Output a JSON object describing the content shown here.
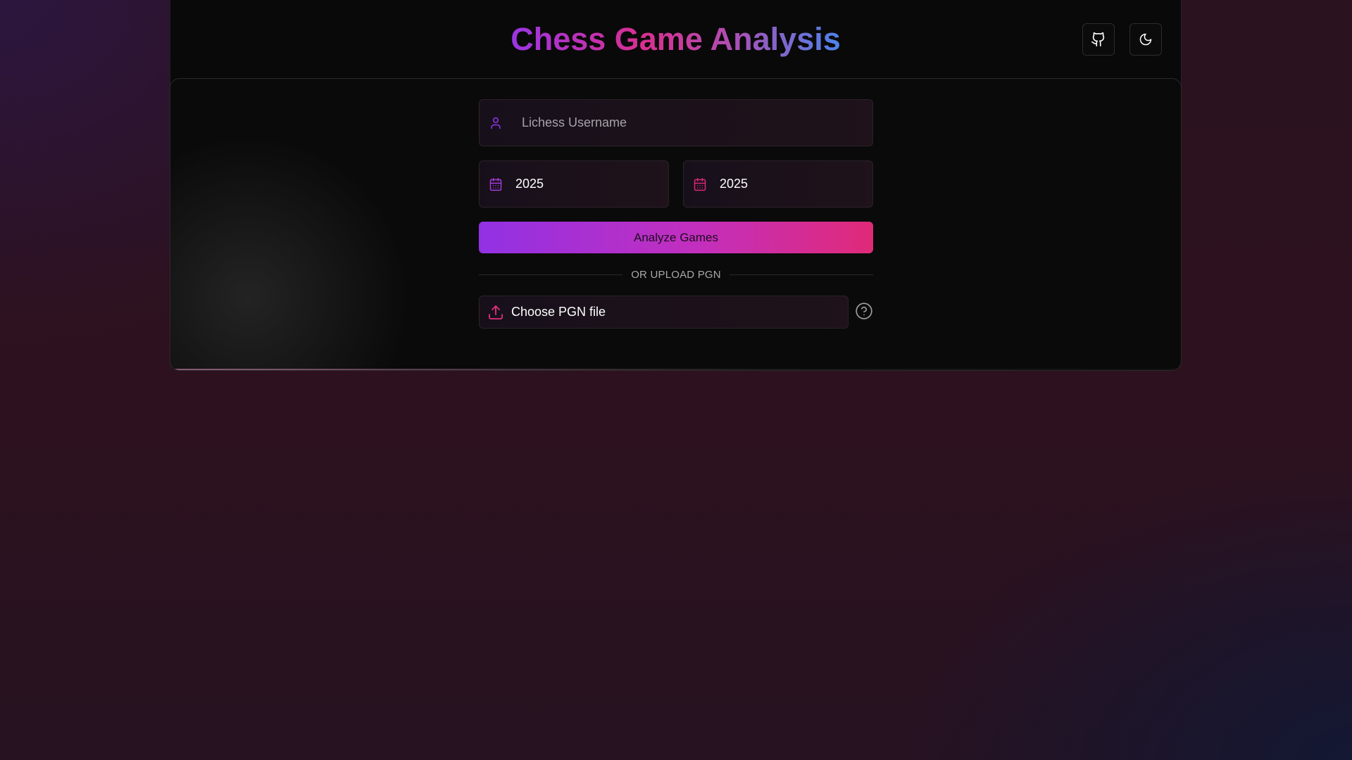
{
  "header": {
    "title": "Chess Game Analysis",
    "github_icon": "github-icon",
    "theme_icon": "moon-icon"
  },
  "form": {
    "username": {
      "placeholder": "Lichess Username",
      "value": "",
      "icon": "user-icon"
    },
    "date_from": {
      "value": "2025",
      "icon": "calendar-icon"
    },
    "date_to": {
      "value": "2025",
      "icon": "calendar-icon"
    },
    "analyze_label": "Analyze Games",
    "divider_label": "OR UPLOAD PGN",
    "upload": {
      "label": "Choose PGN file",
      "icon": "upload-icon"
    },
    "help_icon": "help-circle-icon"
  },
  "colors": {
    "accent_purple": "#9333ea",
    "accent_pink": "#db2777",
    "accent_blue": "#4d83ea"
  }
}
